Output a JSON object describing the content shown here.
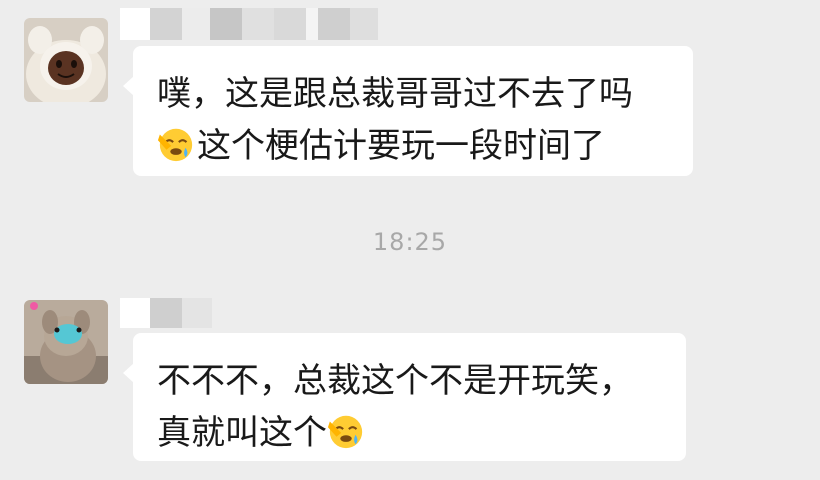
{
  "messages": [
    {
      "lines": [
        "噗，这是跟总裁哥哥过不去了吗",
        "这个梗估计要玩一段时间了"
      ],
      "emoji": "facepalm-emoji",
      "avatar": "hooded-doll-avatar"
    },
    {
      "lines": [
        "不不不，总裁这个不是开玩笑，",
        "真就叫这个"
      ],
      "emoji": "facepalm-emoji",
      "avatar": "dog-with-mask-avatar"
    }
  ],
  "timestamp": "18:25",
  "colors": {
    "background": "#ededed",
    "bubble": "#ffffff",
    "text": "#191919",
    "timestamp": "#a8a8a8"
  }
}
